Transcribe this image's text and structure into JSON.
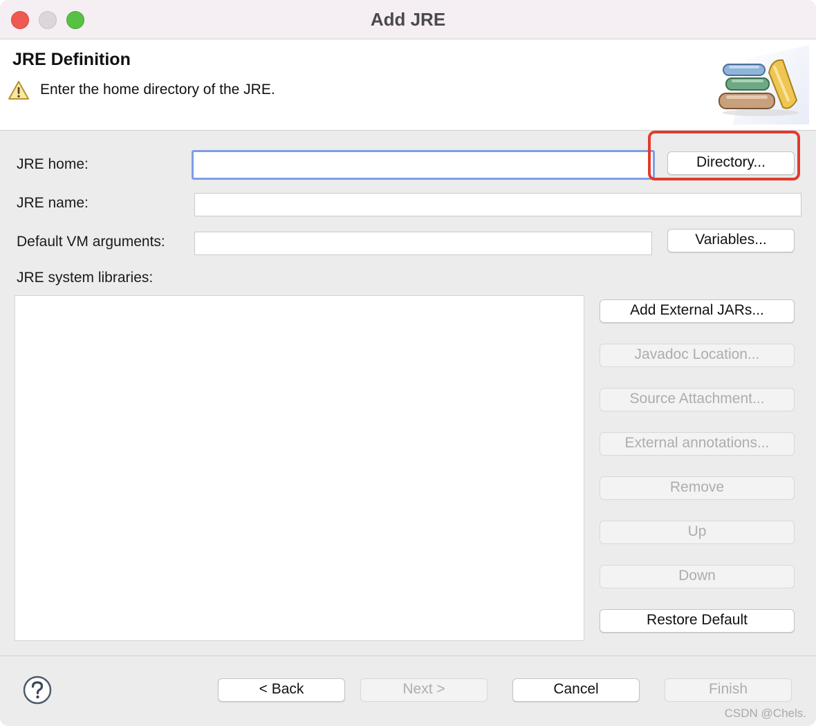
{
  "window": {
    "title": "Add JRE"
  },
  "header": {
    "title": "JRE Definition",
    "message": "Enter the home directory of the JRE.",
    "warning_icon": "warning-icon",
    "banner_icon": "books-icon"
  },
  "form": {
    "jre_home": {
      "label": "JRE home:",
      "value": "",
      "button": "Directory..."
    },
    "jre_name": {
      "label": "JRE name:",
      "value": ""
    },
    "vm_args": {
      "label": "Default VM arguments:",
      "value": "",
      "button": "Variables..."
    },
    "libraries": {
      "label": "JRE system libraries:",
      "items": []
    }
  },
  "library_buttons": [
    {
      "label": "Add External JARs...",
      "enabled": true
    },
    {
      "label": "Javadoc Location...",
      "enabled": false
    },
    {
      "label": "Source Attachment...",
      "enabled": false
    },
    {
      "label": "External annotations...",
      "enabled": false
    },
    {
      "label": "Remove",
      "enabled": false
    },
    {
      "label": "Up",
      "enabled": false
    },
    {
      "label": "Down",
      "enabled": false
    },
    {
      "label": "Restore Default",
      "enabled": true
    }
  ],
  "footer": {
    "back": "< Back",
    "next": "Next >",
    "cancel": "Cancel",
    "finish": "Finish",
    "help_icon": "help-icon"
  },
  "watermark": "CSDN @Chels.",
  "colors": {
    "highlight": "#e23a2e",
    "focus_ring": "#7d9ee6"
  }
}
